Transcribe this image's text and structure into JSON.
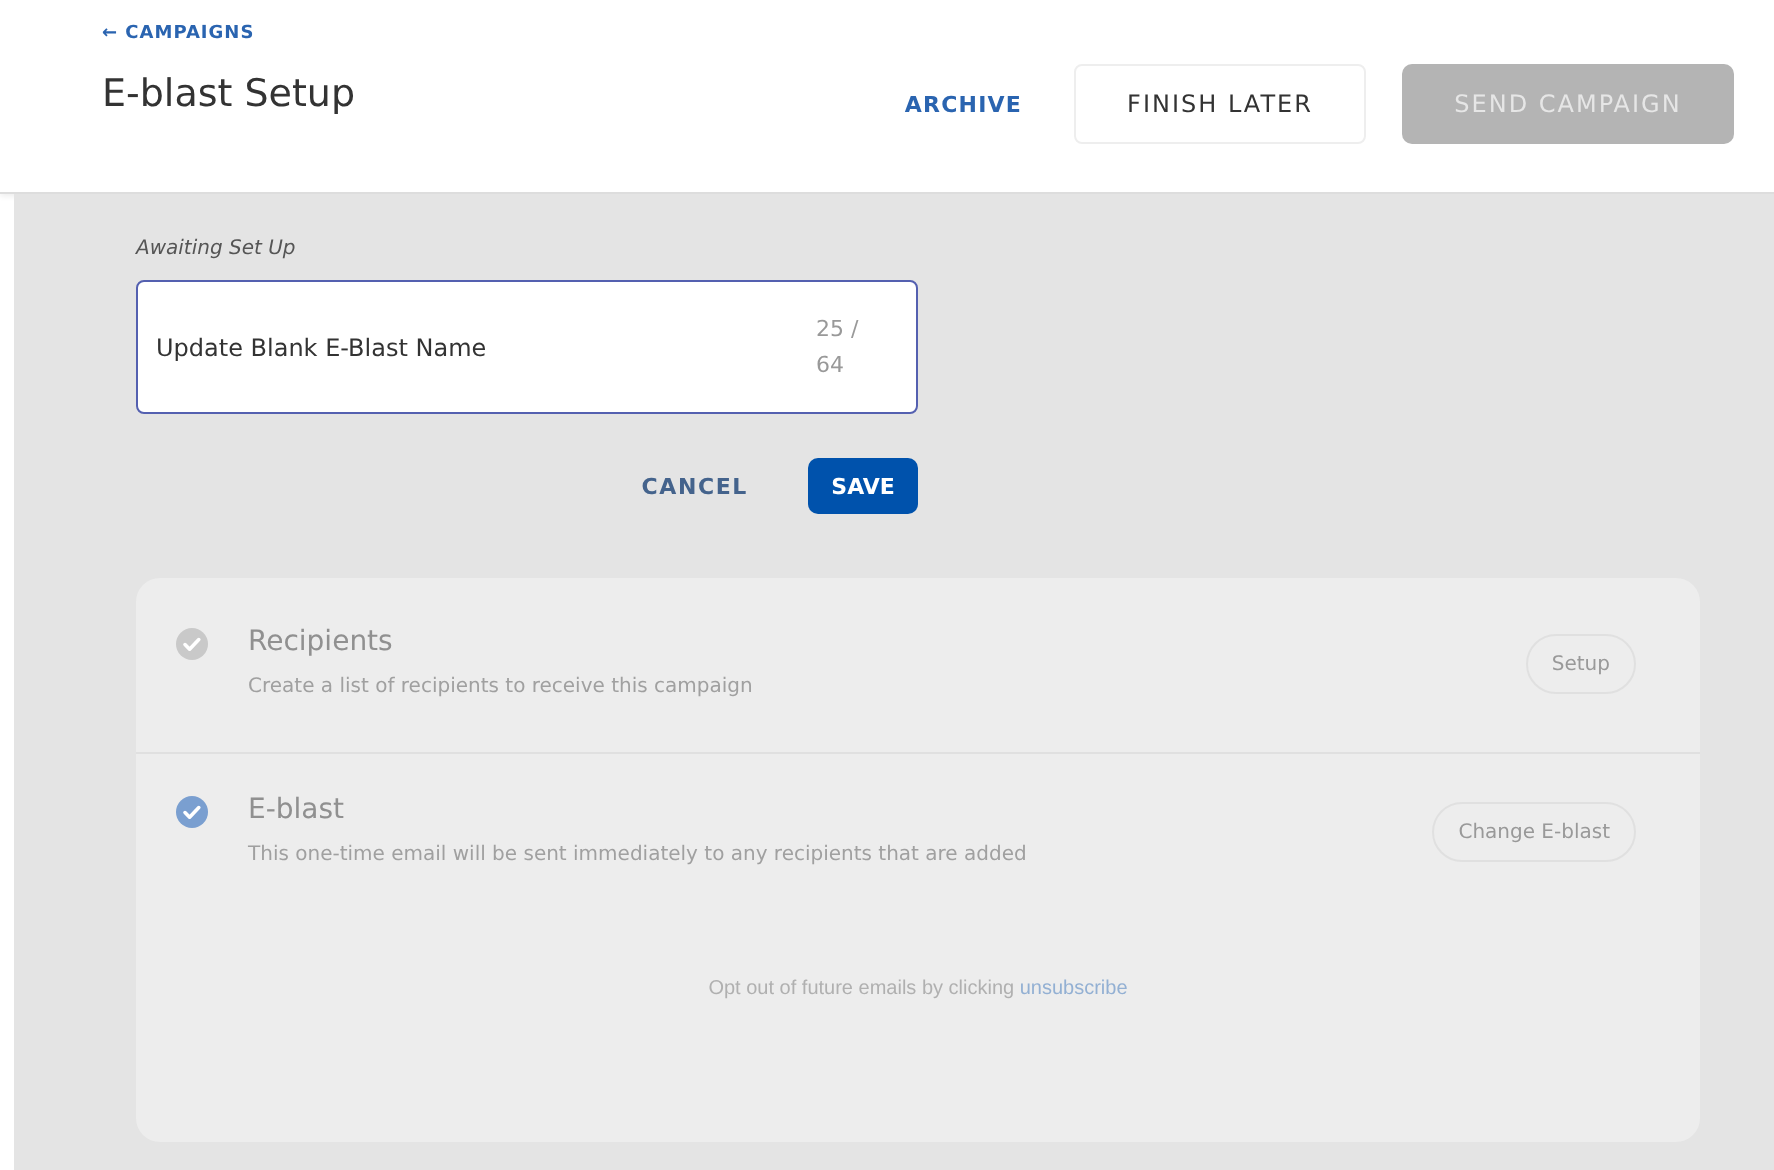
{
  "header": {
    "back_link": "← CAMPAIGNS",
    "title": "E-blast Setup",
    "archive": "ARCHIVE",
    "finish_later": "FINISH LATER",
    "send": {
      "label": "SEND CAMPAIGN",
      "disabled": true
    }
  },
  "name_editor": {
    "status": "Awaiting Set Up",
    "value": "Update Blank E-Blast Name",
    "counter": "25 / 64",
    "cancel": "CANCEL",
    "save": "SAVE"
  },
  "steps": [
    {
      "title": "Recipients",
      "description": "Create a list of recipients to receive this campaign",
      "action": "Setup",
      "done": false
    },
    {
      "title": "E-blast",
      "description": "This one-time email will be sent immediately to any recipients that are added",
      "action": "Change E-blast",
      "done": true
    }
  ],
  "footer": {
    "text": "Opt out of future emails by clicking ",
    "link": "unsubscribe"
  }
}
